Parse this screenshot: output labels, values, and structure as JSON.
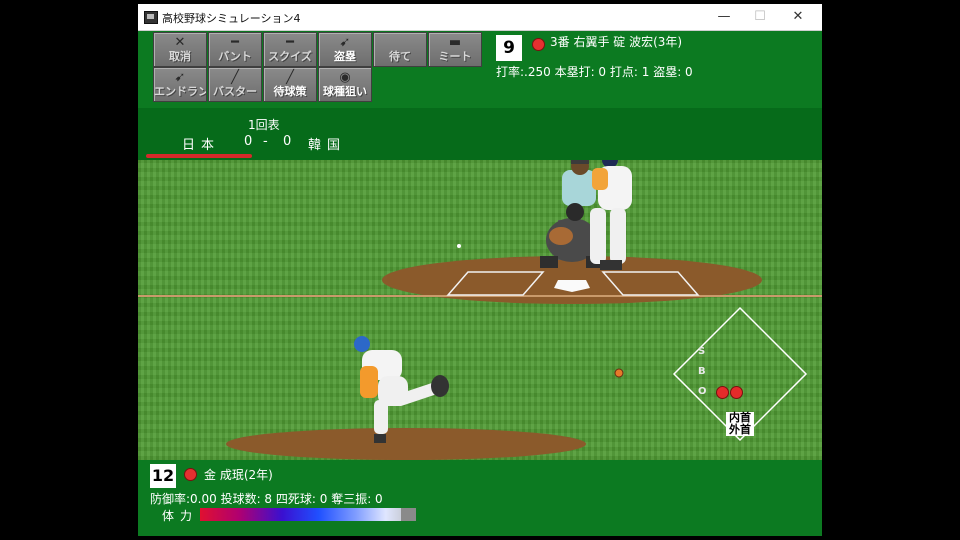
{
  "window": {
    "title": "高校野球シミュレーション4",
    "controls": {
      "minimize": "—",
      "maximize": "☐",
      "close": "✕"
    }
  },
  "commands": [
    {
      "label": "取消",
      "icon": "cancel-icon",
      "glyph": "✕",
      "lit": false
    },
    {
      "label": "バント",
      "icon": "bunt-icon",
      "glyph": "━",
      "lit": false
    },
    {
      "label": "スクイズ",
      "icon": "squeeze-icon",
      "glyph": "━",
      "lit": false
    },
    {
      "label": "盗塁",
      "icon": "steal-icon",
      "glyph": "➹",
      "lit": true
    },
    {
      "label": "待て",
      "icon": "wait-icon",
      "glyph": "",
      "lit": false
    },
    {
      "label": "ミート",
      "icon": "meet-icon",
      "glyph": "▬",
      "lit": false
    },
    {
      "label": "エンドラン",
      "icon": "hit-and-run-icon",
      "glyph": "➹",
      "lit": false
    },
    {
      "label": "バスター",
      "icon": "buster-icon",
      "glyph": "╱",
      "lit": false
    },
    {
      "label": "待球策",
      "icon": "wait-pitch-icon",
      "glyph": "╱",
      "lit": true
    },
    {
      "label": "球種狙い",
      "icon": "pitch-type-icon",
      "glyph": "◉",
      "lit": true
    }
  ],
  "batter": {
    "number": "9",
    "info": "3番 右翼手 碇 波宏(3年)",
    "stats": "打率:.250 本塁打: 0 打点: 1 盗塁: 0"
  },
  "scoreboard": {
    "inning": "1回表",
    "home_team": "日本",
    "home_score": "0",
    "dash": "-",
    "away_score": "0",
    "away_team": "韓国"
  },
  "count": {
    "labels": [
      "S",
      "B",
      "O"
    ],
    "strikes": 0,
    "balls": 0,
    "outs": 2
  },
  "pitch_zone": {
    "label": "内首外首"
  },
  "pitcher": {
    "number": "12",
    "name": "金 成珉(2年)",
    "stats": "防御率:0.00 投球数: 8 四死球: 0 奪三振: 0",
    "stamina_label": "体力",
    "stamina": 0.93
  },
  "colors": {
    "field_green": "#4f9a33",
    "hud_green": "#0c7a21",
    "dirt": "#8b5a2b",
    "accent_red": "#d42a2a"
  }
}
